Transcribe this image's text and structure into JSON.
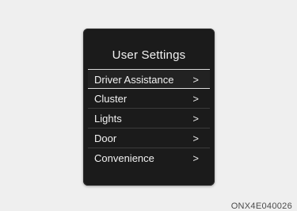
{
  "screen": {
    "title": "User Settings",
    "items": [
      {
        "label": "Driver Assistance",
        "chevron": ">"
      },
      {
        "label": "Cluster",
        "chevron": ">"
      },
      {
        "label": "Lights",
        "chevron": ">"
      },
      {
        "label": "Door",
        "chevron": ">"
      },
      {
        "label": "Convenience",
        "chevron": ">"
      }
    ],
    "selected_index": 0
  },
  "figure_code": "ONX4E040026",
  "colors": {
    "background": "#efefef",
    "screen": "#1b1b1b",
    "text": "#f2f2f2",
    "selection_line": "#dcdcdc"
  }
}
